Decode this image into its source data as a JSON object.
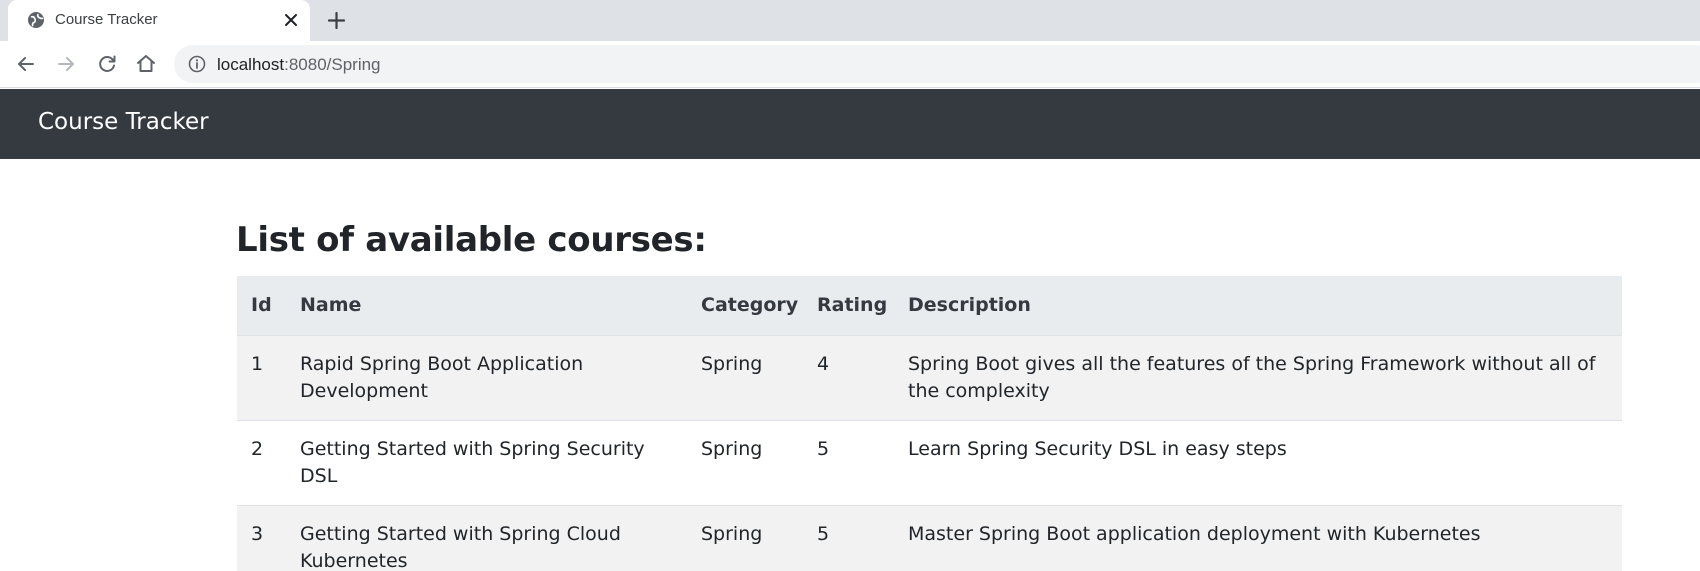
{
  "browser": {
    "tab_title": "Course Tracker",
    "url_host": "localhost",
    "url_rest": ":8080/Spring"
  },
  "app": {
    "brand": "Course Tracker"
  },
  "main": {
    "heading": "List of available courses:",
    "table": {
      "headers": [
        "Id",
        "Name",
        "Category",
        "Rating",
        "Description"
      ],
      "rows": [
        [
          "1",
          "Rapid Spring Boot Application Development",
          "Spring",
          "4",
          "Spring Boot gives all the features of the Spring Framework without all of the complexity"
        ],
        [
          "2",
          "Getting Started with Spring Security DSL",
          "Spring",
          "5",
          "Learn Spring Security DSL in easy steps"
        ],
        [
          "3",
          "Getting Started with Spring Cloud Kubernetes",
          "Spring",
          "5",
          "Master Spring Boot application deployment with Kubernetes"
        ]
      ]
    }
  },
  "icons": {
    "favicon": "globe-icon",
    "tab_close": "close-icon",
    "new_tab": "plus-icon",
    "back": "arrow-left-icon",
    "forward": "arrow-right-icon",
    "reload": "reload-icon",
    "home": "home-icon",
    "site_info": "info-icon"
  },
  "colors": {
    "navbar_bg": "#343a40",
    "table_header_bg": "#e9ecef",
    "table_stripe_bg": "#f2f2f2",
    "tabstrip_bg": "#dee1e6"
  }
}
